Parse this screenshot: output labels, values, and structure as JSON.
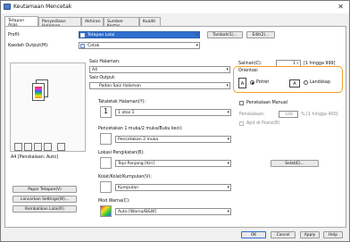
{
  "window": {
    "title": "Keutamaan Mencetak",
    "close_glyph": "✕"
  },
  "tabs": [
    "Tetapan Asas",
    "Penyediaan Halaman",
    "Akhiran",
    "Sumber Kertas",
    "Kualiti"
  ],
  "profile": {
    "label": "Profil:",
    "value": "Tetapan Lalai",
    "add_button": "Tambah(1)...",
    "edit_button": "Edit(2)..."
  },
  "output_method": {
    "label": "Kaedah Output(M):",
    "value": "Cetak"
  },
  "preview": {
    "caption": "A4 [Penskalaan: Auto]"
  },
  "page_size": {
    "label": "Saiz Halaman:",
    "value": "A4"
  },
  "output_size": {
    "label": "Saiz Output:",
    "value": "Padan Saiz Halaman"
  },
  "copies": {
    "label": "Salinan(C):",
    "value": "1",
    "range": "[1 hingga 999]"
  },
  "orientation": {
    "title": "Orientasi",
    "portrait": "Potret",
    "landscape": "Landskap",
    "selected": "Potret",
    "portrait_glyph": "A",
    "landscape_glyph": "A"
  },
  "page_layout": {
    "label": "Tataletak Halaman(Y):",
    "value": "1 atas 1"
  },
  "manual_scaling": {
    "label": "Penskalaan Manual",
    "scale_label": "Penskalaan:",
    "scale_value": "100",
    "scale_range": "% [1 hingga 400]",
    "auto_position": "Apit di Posisi(B)"
  },
  "duplex": {
    "label": "Pencetakan 1 muka/2 muka/Buku kecil:",
    "value": "Pencetakan 2 muka"
  },
  "binding": {
    "label": "Lokasi Pengikatan(B):",
    "value": "Tepi Panjang [Kiri]"
  },
  "binding_button": "Selat(E)...",
  "collate": {
    "label": "Kolat/Kolat/Kumpulan(V):",
    "value": "Kumpulan"
  },
  "color_mode": {
    "label": "Mod Warna(C):",
    "value": "Auto [Warna/B&W]"
  },
  "side_buttons": [
    "Papar Tetapan(V)",
    "Lancarkan Settings(W)...",
    "Kembalikan Lalai(R)"
  ],
  "dialog_buttons": {
    "ok": "OK",
    "cancel": "Cancel",
    "apply": "Apply",
    "help": "Help"
  },
  "colors": {
    "accent_blue": "#2f6fcf",
    "orientation_highlight": "#f0a020"
  }
}
